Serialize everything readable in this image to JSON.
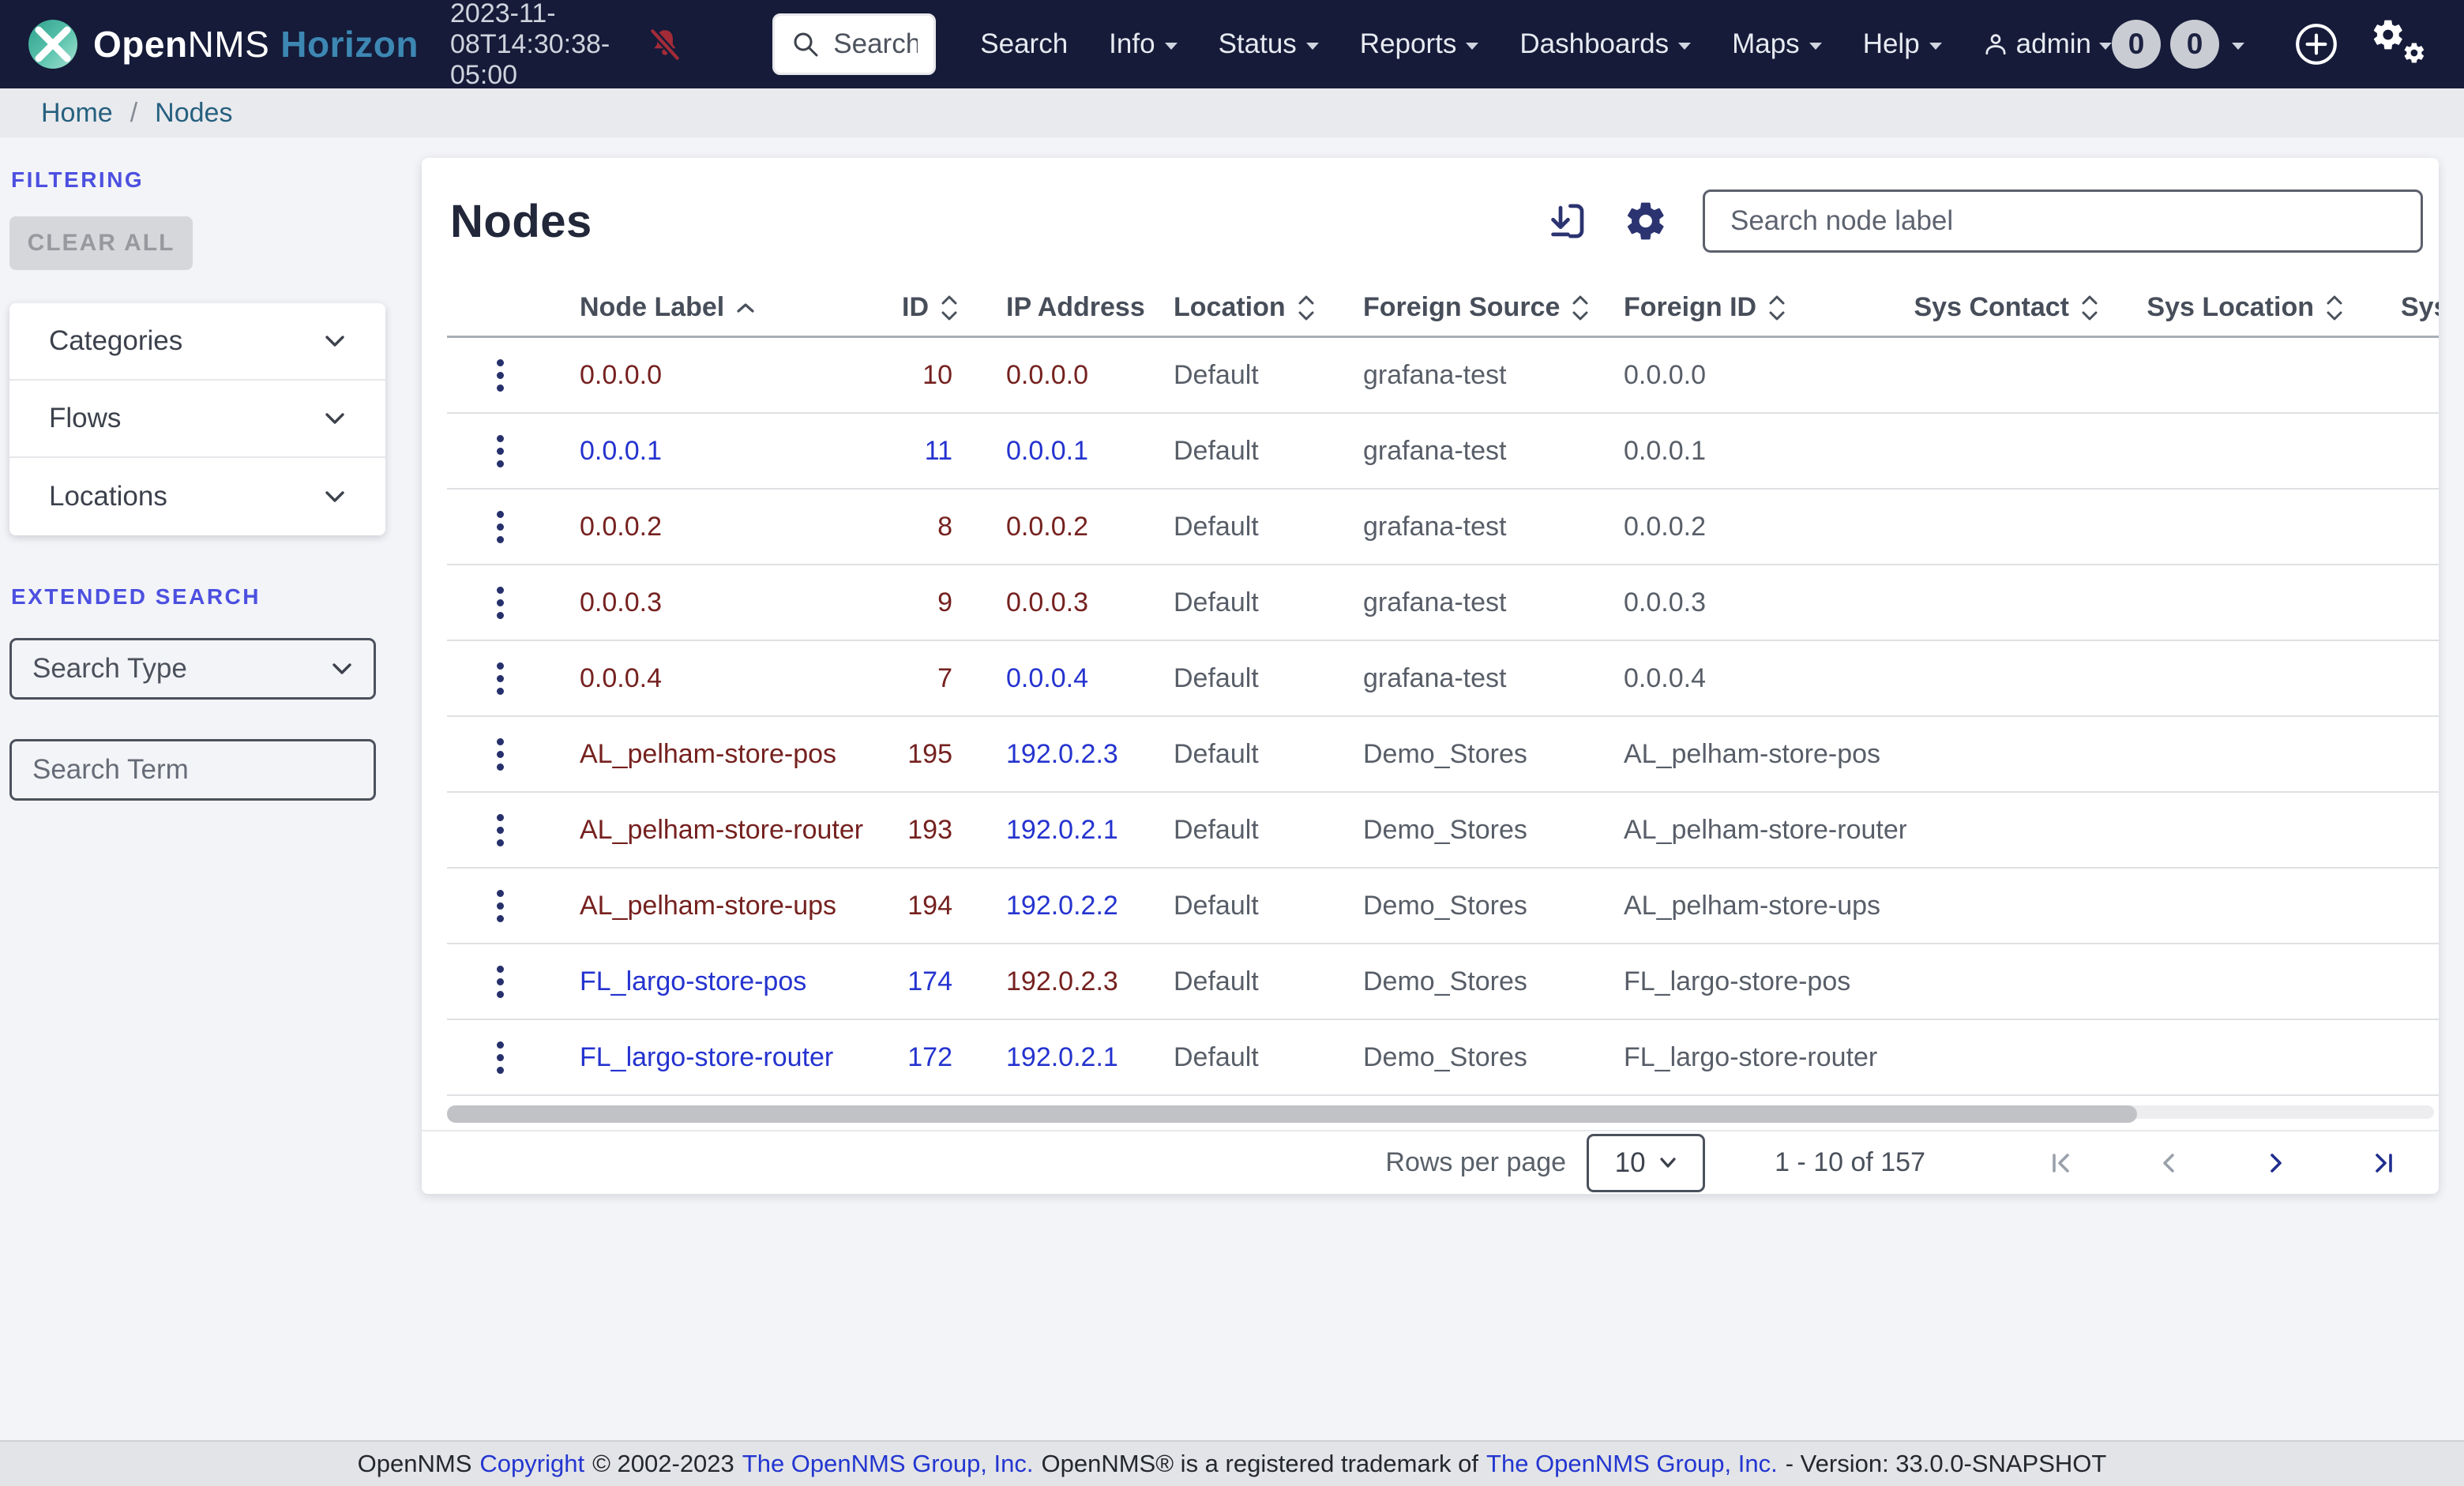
{
  "navbar": {
    "brand_open": "Open",
    "brand_nms": "NMS",
    "brand_product": "Horizon",
    "timestamp": "2023-11-08T14:30:38-05:00",
    "search_placeholder": "Search...",
    "menu": [
      {
        "label": "Search"
      },
      {
        "label": "Info"
      },
      {
        "label": "Status"
      },
      {
        "label": "Reports"
      },
      {
        "label": "Dashboards"
      },
      {
        "label": "Maps"
      },
      {
        "label": "Help"
      }
    ],
    "user_label": "admin",
    "notices_badge": "0",
    "outages_badge": "0"
  },
  "breadcrumb": {
    "home": "Home",
    "separator": "/",
    "current": "Nodes"
  },
  "sidebar": {
    "filtering_heading": "FILTERING",
    "clear_all_label": "CLEAR ALL",
    "accordions": [
      {
        "label": "Categories"
      },
      {
        "label": "Flows"
      },
      {
        "label": "Locations"
      }
    ],
    "extended_heading": "EXTENDED SEARCH",
    "search_type_value": "Search Type",
    "search_term_placeholder": "Search Term"
  },
  "main": {
    "title": "Nodes",
    "search_placeholder": "Search node label",
    "table": {
      "headers": [
        {
          "label": "Node Label",
          "sort": "asc"
        },
        {
          "label": "ID",
          "sort": "both"
        },
        {
          "label": "IP Address",
          "sort": "none"
        },
        {
          "label": "Location",
          "sort": "both"
        },
        {
          "label": "Foreign Source",
          "sort": "both"
        },
        {
          "label": "Foreign ID",
          "sort": "both"
        },
        {
          "label": "Sys Contact",
          "sort": "both"
        },
        {
          "label": "Sys Location",
          "sort": "both"
        },
        {
          "label": "Sys D",
          "sort": "both"
        }
      ],
      "rows": [
        {
          "label": "0.0.0.0",
          "label_color": "red",
          "id": "10",
          "id_color": "red",
          "ip": "0.0.0.0",
          "ip_color": "red",
          "location": "Default",
          "foreign_source": "grafana-test",
          "foreign_id": "0.0.0.0"
        },
        {
          "label": "0.0.0.1",
          "label_color": "blue",
          "id": "11",
          "id_color": "blue",
          "ip": "0.0.0.1",
          "ip_color": "blue",
          "location": "Default",
          "foreign_source": "grafana-test",
          "foreign_id": "0.0.0.1"
        },
        {
          "label": "0.0.0.2",
          "label_color": "red",
          "id": "8",
          "id_color": "red",
          "ip": "0.0.0.2",
          "ip_color": "red",
          "location": "Default",
          "foreign_source": "grafana-test",
          "foreign_id": "0.0.0.2"
        },
        {
          "label": "0.0.0.3",
          "label_color": "red",
          "id": "9",
          "id_color": "red",
          "ip": "0.0.0.3",
          "ip_color": "red",
          "location": "Default",
          "foreign_source": "grafana-test",
          "foreign_id": "0.0.0.3"
        },
        {
          "label": "0.0.0.4",
          "label_color": "red",
          "id": "7",
          "id_color": "red",
          "ip": "0.0.0.4",
          "ip_color": "blue",
          "location": "Default",
          "foreign_source": "grafana-test",
          "foreign_id": "0.0.0.4"
        },
        {
          "label": "AL_pelham-store-pos",
          "label_color": "red",
          "id": "195",
          "id_color": "red",
          "ip": "192.0.2.3",
          "ip_color": "blue",
          "location": "Default",
          "foreign_source": "Demo_Stores",
          "foreign_id": "AL_pelham-store-pos"
        },
        {
          "label": "AL_pelham-store-router",
          "label_color": "red",
          "id": "193",
          "id_color": "red",
          "ip": "192.0.2.1",
          "ip_color": "blue",
          "location": "Default",
          "foreign_source": "Demo_Stores",
          "foreign_id": "AL_pelham-store-router"
        },
        {
          "label": "AL_pelham-store-ups",
          "label_color": "red",
          "id": "194",
          "id_color": "red",
          "ip": "192.0.2.2",
          "ip_color": "blue",
          "location": "Default",
          "foreign_source": "Demo_Stores",
          "foreign_id": "AL_pelham-store-ups"
        },
        {
          "label": "FL_largo-store-pos",
          "label_color": "blue",
          "id": "174",
          "id_color": "blue",
          "ip": "192.0.2.3",
          "ip_color": "red",
          "location": "Default",
          "foreign_source": "Demo_Stores",
          "foreign_id": "FL_largo-store-pos"
        },
        {
          "label": "FL_largo-store-router",
          "label_color": "blue",
          "id": "172",
          "id_color": "blue",
          "ip": "192.0.2.1",
          "ip_color": "blue",
          "location": "Default",
          "foreign_source": "Demo_Stores",
          "foreign_id": "FL_largo-store-router"
        }
      ]
    },
    "pagination": {
      "rows_per_page_label": "Rows per page",
      "page_size": "10",
      "range_text": "1 - 10 of 157"
    }
  },
  "footer": {
    "prefix": "OpenNMS",
    "copyright_link": "Copyright",
    "years": "© 2002-2023",
    "group_link_1": "The OpenNMS Group, Inc.",
    "middle": "OpenNMS® is a registered trademark of",
    "group_link_2": "The OpenNMS Group, Inc.",
    "version": "- Version: 33.0.0-SNAPSHOT"
  },
  "colors": {
    "navbar_bg": "#151b38",
    "accent_indigo": "#4c50e0",
    "link_blue": "#2433cf",
    "link_red": "#75211f",
    "horizon_blue": "#3d87b3",
    "icon_navy": "#2b3470",
    "bell_red": "#a32b38"
  }
}
